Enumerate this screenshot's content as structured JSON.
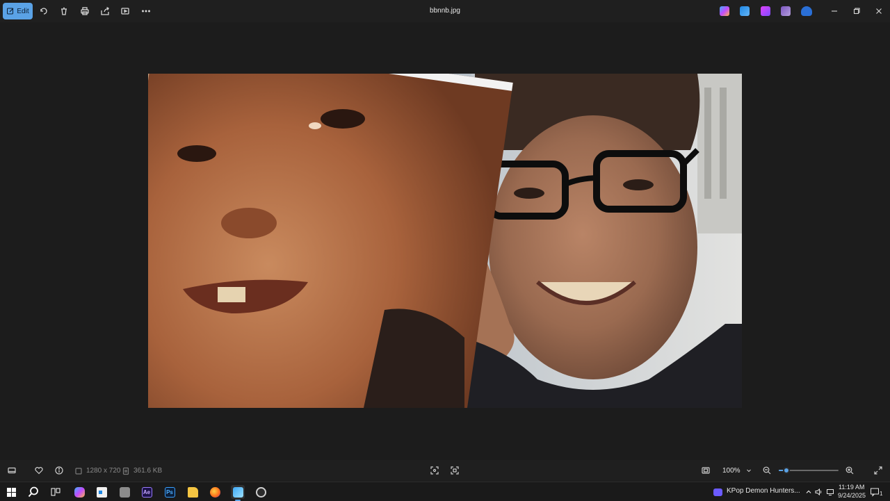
{
  "toolbar": {
    "edit_label": "Edit",
    "file_title": "bbnnb.jpg"
  },
  "image_info": {
    "dimensions": "1280 x 720",
    "file_size": "361.6 KB"
  },
  "zoom": {
    "value": "100%",
    "level_percent": 13
  },
  "taskbar": {
    "news_label": "KPop Demon Hunters...",
    "time": "11:19 AM",
    "date": "9/24/2025",
    "notification_count": "1"
  },
  "colors": {
    "accent": "#5aa2e6",
    "background": "#1c1c1c"
  }
}
